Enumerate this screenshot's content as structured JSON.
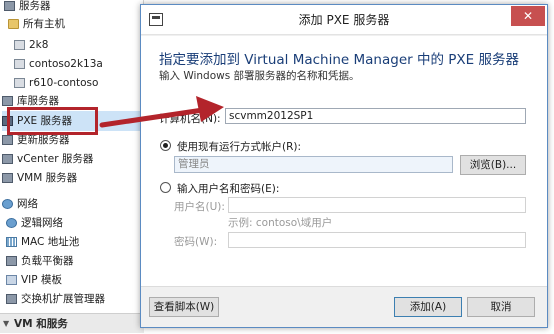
{
  "nav": {
    "items": [
      {
        "label": "服务器",
        "icon": "server-icon"
      },
      {
        "label": "所有主机",
        "icon": "folder-icon"
      },
      {
        "label": "2k8",
        "icon": "host-icon"
      },
      {
        "label": "contoso2k13a",
        "icon": "host-icon"
      },
      {
        "label": "r610-contoso",
        "icon": "host-icon"
      },
      {
        "label": "库服务器",
        "icon": "server-icon"
      },
      {
        "label": "PXE 服务器",
        "icon": "pxe-server-icon"
      },
      {
        "label": "更新服务器",
        "icon": "server-icon"
      },
      {
        "label": "vCenter 服务器",
        "icon": "server-icon"
      },
      {
        "label": "VMM 服务器",
        "icon": "server-icon"
      },
      {
        "label": "网络",
        "icon": "network-icon"
      },
      {
        "label": "逻辑网络",
        "icon": "network-icon"
      },
      {
        "label": "MAC 地址池",
        "icon": "grid-icon"
      },
      {
        "label": "负载平衡器",
        "icon": "server-icon"
      },
      {
        "label": "VIP 模板",
        "icon": "vip-icon"
      },
      {
        "label": "交换机扩展管理器",
        "icon": "server-icon"
      }
    ],
    "section_bottom": "VM 和服务"
  },
  "dialog": {
    "title": "添加 PXE 服务器",
    "close_label": "✕",
    "heading": "指定要添加到 Virtual Machine Manager 中的 PXE 服务器",
    "subheading": "输入 Windows 部署服务器的名称和凭据。",
    "computer_name_label": "计算机名(N):",
    "computer_name_value": "scvmm2012SP1",
    "runas_option_label": "使用现有运行方式帐户(R):",
    "runas_value": "管理员",
    "browse_label": "浏览(B)...",
    "manual_option_label": "输入用户名和密码(E):",
    "username_label": "用户名(U):",
    "username_value": "",
    "example_text": "示例: contoso\\域用户",
    "password_label": "密码(W):",
    "password_value": "",
    "view_script_label": "查看脚本(W)",
    "add_label": "添加(A)",
    "cancel_label": "取消"
  },
  "colors": {
    "annotation": "#b3242b",
    "heading": "#1a3e78",
    "close_button": "#c75050"
  }
}
